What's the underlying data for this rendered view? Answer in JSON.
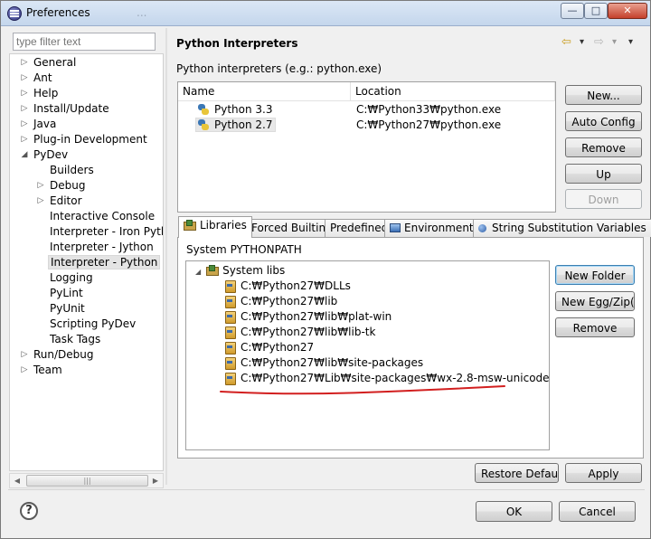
{
  "window": {
    "title": "Preferences",
    "ghost_title": "...",
    "minimize": "—",
    "maximize": "□",
    "close": "✕"
  },
  "filter": {
    "placeholder": "type filter text"
  },
  "tree": [
    {
      "label": "General",
      "twisty": "▷"
    },
    {
      "label": "Ant",
      "twisty": "▷"
    },
    {
      "label": "Help",
      "twisty": "▷"
    },
    {
      "label": "Install/Update",
      "twisty": "▷"
    },
    {
      "label": "Java",
      "twisty": "▷"
    },
    {
      "label": "Plug-in Development",
      "twisty": "▷"
    },
    {
      "label": "PyDev",
      "twisty": "◢"
    },
    {
      "label": "Builders",
      "twisty": ""
    },
    {
      "label": "Debug",
      "twisty": "▷"
    },
    {
      "label": "Editor",
      "twisty": "▷"
    },
    {
      "label": "Interactive Console",
      "twisty": ""
    },
    {
      "label": "Interpreter - Iron Pytho",
      "twisty": ""
    },
    {
      "label": "Interpreter - Jython",
      "twisty": ""
    },
    {
      "label": "Interpreter - Python",
      "twisty": "",
      "selected": true
    },
    {
      "label": "Logging",
      "twisty": ""
    },
    {
      "label": "PyLint",
      "twisty": ""
    },
    {
      "label": "PyUnit",
      "twisty": ""
    },
    {
      "label": "Scripting PyDev",
      "twisty": ""
    },
    {
      "label": "Task Tags",
      "twisty": ""
    },
    {
      "label": "Run/Debug",
      "twisty": "▷"
    },
    {
      "label": "Team",
      "twisty": "▷"
    }
  ],
  "scroll_grip": "|||",
  "page": {
    "title": "Python Interpreters",
    "description": "Python interpreters (e.g.: python.exe)",
    "nav": {
      "back": "⇦",
      "back_menu": "▾",
      "forward": "⇨",
      "forward_menu": "▾",
      "view_menu": "▾"
    }
  },
  "interpreters": {
    "columns": [
      "Name",
      "Location"
    ],
    "rows": [
      {
        "name": "Python 3.3",
        "location": "C:₩Python33₩python.exe"
      },
      {
        "name": "Python 2.7",
        "location": "C:₩Python27₩python.exe"
      }
    ]
  },
  "interp_buttons": {
    "new": "New...",
    "auto": "Auto Config",
    "remove": "Remove",
    "up": "Up",
    "down": "Down"
  },
  "tabs": [
    "Libraries",
    "Forced Builtins",
    "Predefined",
    "Environment",
    "String Substitution Variables"
  ],
  "libraries": {
    "label": "System PYTHONPATH",
    "root": "System libs",
    "paths": [
      "C:₩Python27₩DLLs",
      "C:₩Python27₩lib",
      "C:₩Python27₩lib₩plat-win",
      "C:₩Python27₩lib₩lib-tk",
      "C:₩Python27",
      "C:₩Python27₩lib₩site-packages",
      "C:₩Python27₩Lib₩site-packages₩wx-2.8-msw-unicode"
    ],
    "highlight_color": "#d21f1f"
  },
  "lib_buttons": {
    "new_folder": "New Folder",
    "new_egg": "New Egg/Zip(s)",
    "remove": "Remove"
  },
  "footer": {
    "restore": "Restore Defaults",
    "apply": "Apply",
    "ok": "OK",
    "cancel": "Cancel",
    "help": "?"
  }
}
